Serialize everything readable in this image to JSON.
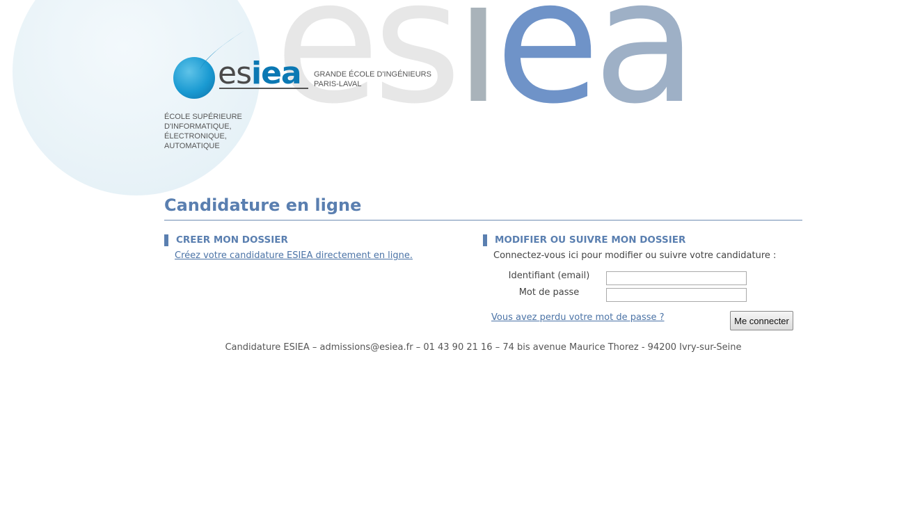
{
  "header": {
    "logo": {
      "text_es": "es",
      "text_iea": "iea"
    },
    "big_word": {
      "es": "es",
      "i": "i",
      "e": "e",
      "a": "a"
    },
    "tagline": [
      "GRANDE ÉCOLE D'INGÉNIEURS",
      "PARIS-LAVAL"
    ],
    "school_desc": [
      "ÉCOLE SUPÉRIEURE",
      "D'INFORMATIQUE,",
      "ÉLECTRONIQUE,",
      "AUTOMATIQUE"
    ]
  },
  "main": {
    "title": "Candidature en ligne",
    "create": {
      "heading": "CREER MON DOSSIER",
      "link": "Créez votre candidature ESIEA directement en ligne."
    },
    "modify": {
      "heading": "MODIFIER OU SUIVRE MON DOSSIER",
      "intro": "Connectez-vous ici pour modifier ou suivre votre candidature :",
      "id_label": "Identifiant (email)",
      "id_value": "",
      "pw_label": "Mot de passe",
      "pw_value": "",
      "lost_link": "Vous avez perdu votre mot de passe ?",
      "submit": "Me connecter"
    }
  },
  "footer": {
    "text": "Candidature ESIEA – admissions@esiea.fr – 01 43 90 21 16 – 74 bis avenue Maurice Thorez - 94200 Ivry-sur-Seine"
  },
  "colors": {
    "accent": "#5a7fb0",
    "link": "#4b73a6",
    "logo_blue": "#0b78b3"
  }
}
